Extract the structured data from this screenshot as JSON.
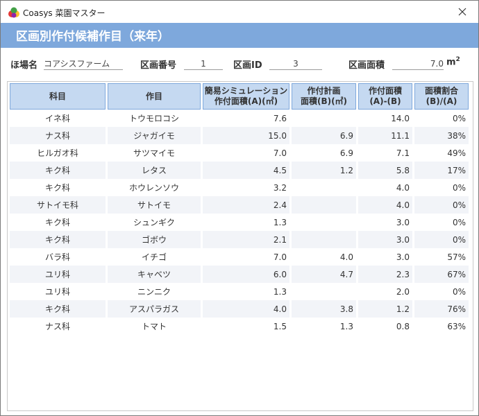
{
  "window": {
    "app_title": "Coasys 菜園マスター",
    "close_icon": "close-icon",
    "app_icon": "fruit-logo-icon"
  },
  "header": {
    "title": "区画別作付候補作目（来年）"
  },
  "info": {
    "farm_label": "ほ場名",
    "farm_value": "コアシスファーム",
    "plot_number_label": "区画番号",
    "plot_number_value": "1",
    "plot_id_label": "区画ID",
    "plot_id_value": "3",
    "area_label": "区画面積",
    "area_value": "7.0",
    "area_unit": "m",
    "area_unit_exp": "2"
  },
  "table": {
    "columns": [
      {
        "line1": "科目",
        "line2": ""
      },
      {
        "line1": "作目",
        "line2": ""
      },
      {
        "line1": "簡易シミュレーション",
        "line2": "作付面積(A)(㎡)"
      },
      {
        "line1": "作付計画",
        "line2": "面積(B)(㎡)"
      },
      {
        "line1": "作付面積",
        "line2": "(A)-(B)"
      },
      {
        "line1": "面積割合",
        "line2": "(B)/(A)"
      }
    ],
    "rows": [
      {
        "family": "イネ科",
        "crop": "トウモロコシ",
        "sim_area": "7.6",
        "plan_area": "",
        "diff": "14.0",
        "ratio": "0%"
      },
      {
        "family": "ナス科",
        "crop": "ジャガイモ",
        "sim_area": "15.0",
        "plan_area": "6.9",
        "diff": "11.1",
        "ratio": "38%"
      },
      {
        "family": "ヒルガオ科",
        "crop": "サツマイモ",
        "sim_area": "7.0",
        "plan_area": "6.9",
        "diff": "7.1",
        "ratio": "49%"
      },
      {
        "family": "キク科",
        "crop": "レタス",
        "sim_area": "4.5",
        "plan_area": "1.2",
        "diff": "5.8",
        "ratio": "17%"
      },
      {
        "family": "キク科",
        "crop": "ホウレンソウ",
        "sim_area": "3.2",
        "plan_area": "",
        "diff": "4.0",
        "ratio": "0%"
      },
      {
        "family": "サトイモ科",
        "crop": "サトイモ",
        "sim_area": "2.4",
        "plan_area": "",
        "diff": "4.0",
        "ratio": "0%"
      },
      {
        "family": "キク科",
        "crop": "シュンギク",
        "sim_area": "1.3",
        "plan_area": "",
        "diff": "3.0",
        "ratio": "0%"
      },
      {
        "family": "キク科",
        "crop": "ゴボウ",
        "sim_area": "2.1",
        "plan_area": "",
        "diff": "3.0",
        "ratio": "0%"
      },
      {
        "family": "バラ科",
        "crop": "イチゴ",
        "sim_area": "7.0",
        "plan_area": "4.0",
        "diff": "3.0",
        "ratio": "57%"
      },
      {
        "family": "ユリ科",
        "crop": "キャベツ",
        "sim_area": "6.0",
        "plan_area": "4.7",
        "diff": "2.3",
        "ratio": "67%"
      },
      {
        "family": "ユリ科",
        "crop": "ニンニク",
        "sim_area": "1.3",
        "plan_area": "",
        "diff": "2.0",
        "ratio": "0%"
      },
      {
        "family": "キク科",
        "crop": "アスパラガス",
        "sim_area": "4.0",
        "plan_area": "3.8",
        "diff": "1.2",
        "ratio": "76%"
      },
      {
        "family": "ナス科",
        "crop": "トマト",
        "sim_area": "1.5",
        "plan_area": "1.3",
        "diff": "0.8",
        "ratio": "63%"
      }
    ]
  },
  "colors": {
    "header_band": "#7ea8dc",
    "column_header_bg": "#c5d9f1",
    "column_header_border": "#7ea8dc",
    "alt_row_bg": "#f2f4f8"
  }
}
